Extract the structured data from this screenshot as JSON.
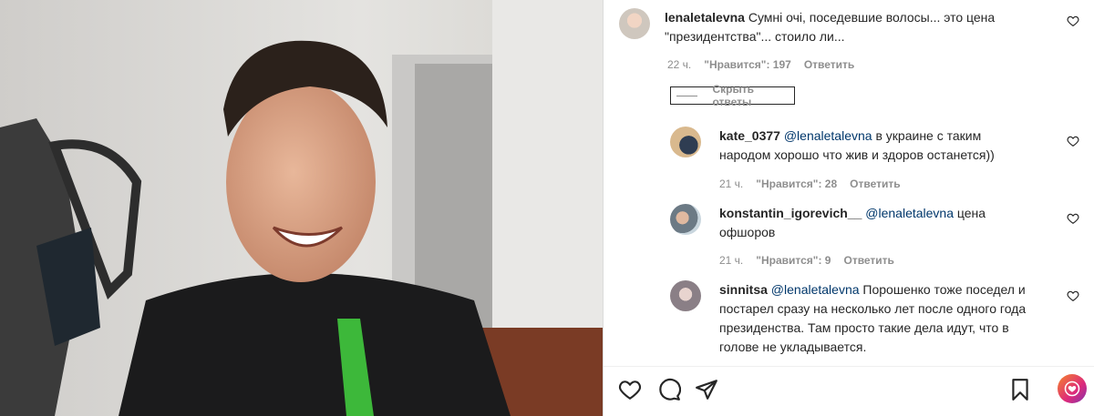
{
  "post": {
    "author": "lenaletalevna",
    "caption_line1": "Сумні очі, поседевшие волосы... это цена",
    "caption_line2": "\"президентства\"... стоило ли...",
    "time": "22 ч.",
    "likes": "\"Нравится\": 197",
    "reply": "Ответить"
  },
  "hide_replies_label": "Скрыть ответы",
  "replies": [
    {
      "user": "kate_0377",
      "mention": "@lenaletalevna",
      "text_line1": " в украине с таким",
      "text_line2": "народом хорошо что жив и здоров останется))",
      "time": "21 ч.",
      "likes": "\"Нравится\": 28",
      "reply": "Ответить"
    },
    {
      "user": "konstantin_igorevich__",
      "mention": "@lenaletalevna",
      "text_line1": " цена",
      "text_line2": "офшоров",
      "time": "21 ч.",
      "likes": "\"Нравится\": 9",
      "reply": "Ответить"
    },
    {
      "user": "sinnitsa",
      "mention": "@lenaletalevna",
      "text_line1": " Порошенко тоже поседел и",
      "text_line2": "постарел сразу на несколько лет после одного года",
      "text_line3": "президенства. Там просто такие дела идут, что в",
      "text_line4": "голове не укладывается."
    }
  ],
  "icons": {
    "like": "heart-icon",
    "comment": "comment-icon",
    "share": "share-icon",
    "save": "bookmark-icon",
    "fab": "heart-badge-icon"
  }
}
